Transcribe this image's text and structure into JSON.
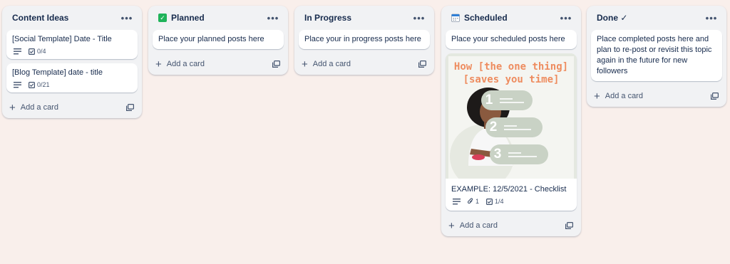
{
  "lists": [
    {
      "title": "Content Ideas",
      "cards": [
        {
          "text": "[Social Template] Date - Title",
          "checklist": "0/4"
        },
        {
          "text": "[Blog Template] date - title",
          "checklist": "0/21"
        }
      ],
      "add_card": "Add a card"
    },
    {
      "title": "Planned",
      "icon": "green-check-icon",
      "cards": [
        {
          "text": "Place your planned posts here"
        }
      ],
      "add_card": "Add a card"
    },
    {
      "title": "In Progress",
      "cards": [
        {
          "text": "Place your in progress posts here"
        }
      ],
      "add_card": "Add a card"
    },
    {
      "title": "Scheduled",
      "icon": "calendar-icon",
      "cards": [
        {
          "text": "Place your scheduled posts here"
        },
        {
          "text": "EXAMPLE: 12/5/2021 - Checklist",
          "attachments": "1",
          "checklist": "1/4",
          "cover": {
            "title_line1": "How [the one thing]",
            "title_line2": "[saves you time]",
            "steps": [
              "1",
              "2",
              "3"
            ]
          }
        }
      ],
      "add_card": "Add a card"
    },
    {
      "title": "Done ✓",
      "cards": [
        {
          "text": "Place completed posts here and plan to re-post or revisit this topic again in the future for new followers"
        }
      ],
      "add_card": "Add a card"
    }
  ],
  "colors": {
    "background": "#f9efeb",
    "list": "#f1f2f4",
    "accent_orange": "#ee8c5f",
    "pill_sage": "#c9d2c5",
    "check_green": "#1fb35a"
  }
}
